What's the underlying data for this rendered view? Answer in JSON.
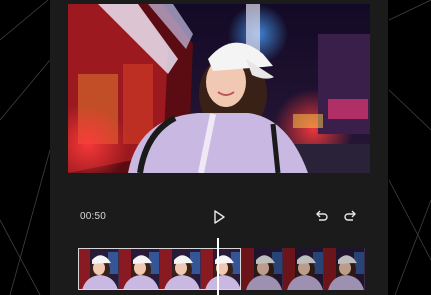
{
  "player": {
    "current_time": "00:50",
    "play_icon": "play-icon",
    "undo_icon": "undo-icon",
    "redo_icon": "redo-icon"
  },
  "timeline": {
    "frame_count": 7,
    "selected_frames": 4
  },
  "colors": {
    "background": "#000000",
    "panel": "#1b1b1b",
    "control_text": "#d8d8d8",
    "playhead": "#ffffff"
  }
}
